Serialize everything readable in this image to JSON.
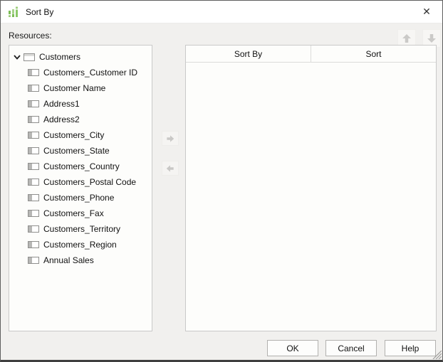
{
  "window": {
    "title": "Sort By",
    "close_glyph": "✕"
  },
  "colors": {
    "accent_green": "#8cc968",
    "accent_green_dark": "#6fb54a",
    "body_bg": "#f1f0ee",
    "panel_bg": "#fdfdfb",
    "panel_border": "#c9c9c9",
    "disabled_arrow": "#c9c8c6"
  },
  "resources_label": "Resources:",
  "tree": {
    "root": {
      "label": "Customers",
      "expanded": true
    },
    "items": [
      {
        "label": "Customers_Customer ID"
      },
      {
        "label": "Customer Name"
      },
      {
        "label": "Address1"
      },
      {
        "label": "Address2"
      },
      {
        "label": "Customers_City"
      },
      {
        "label": "Customers_State"
      },
      {
        "label": "Customers_Country"
      },
      {
        "label": "Customers_Postal Code"
      },
      {
        "label": "Customers_Phone"
      },
      {
        "label": "Customers_Fax"
      },
      {
        "label": "Customers_Territory"
      },
      {
        "label": "Customers_Region"
      },
      {
        "label": "Annual Sales"
      }
    ]
  },
  "table": {
    "columns": [
      {
        "label": "Sort By"
      },
      {
        "label": "Sort"
      }
    ],
    "rows": []
  },
  "buttons": {
    "ok": "OK",
    "cancel": "Cancel",
    "help": "Help"
  }
}
